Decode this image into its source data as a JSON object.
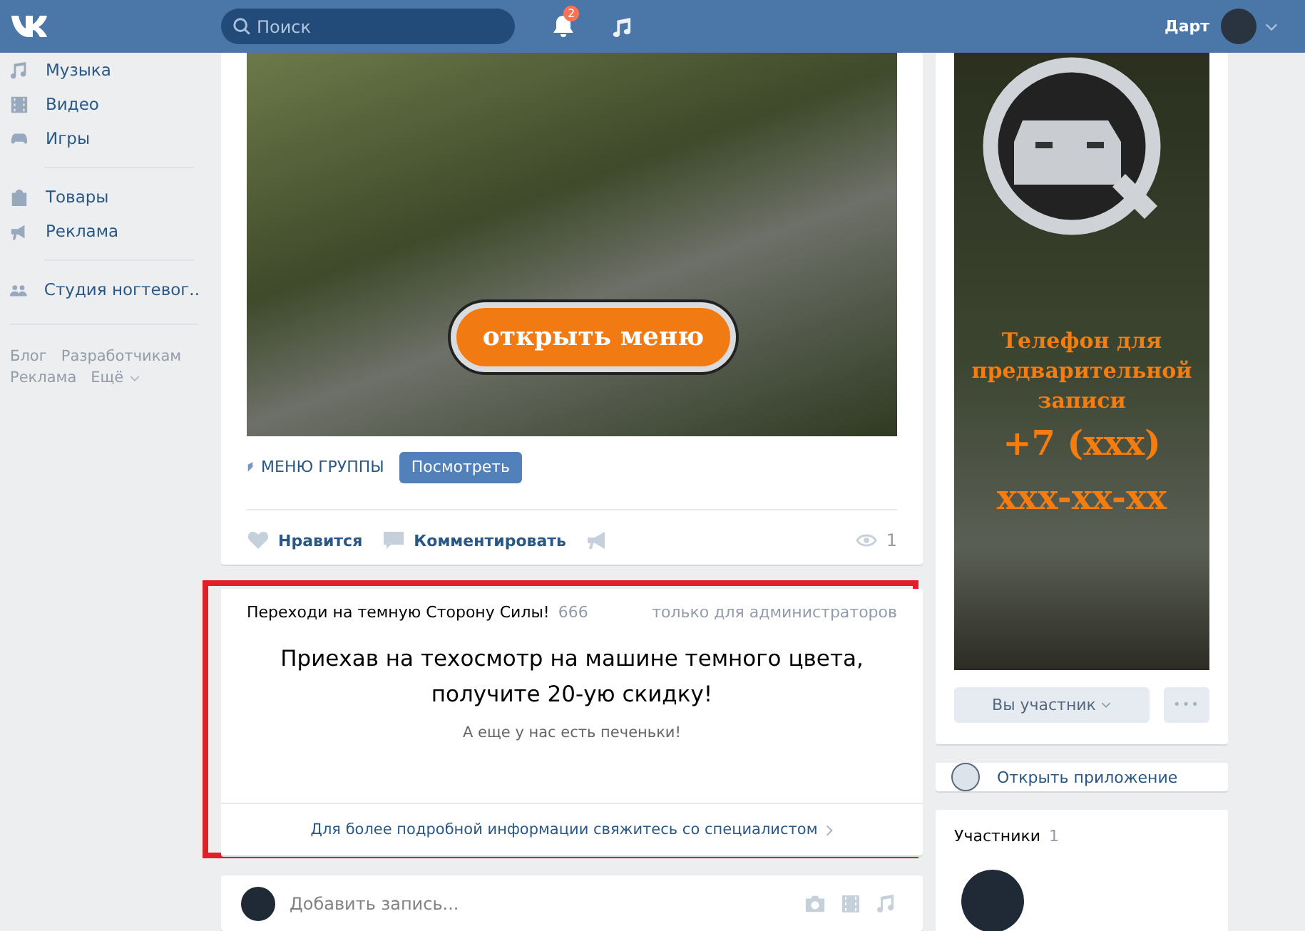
{
  "header": {
    "search": {
      "placeholder": "Поиск"
    },
    "notifications": {
      "count": "2"
    },
    "user": {
      "name": "Дарт"
    }
  },
  "sidebar": {
    "items": [
      {
        "label": "Музыка"
      },
      {
        "label": "Видео"
      },
      {
        "label": "Игры"
      },
      {
        "label": "Товары"
      },
      {
        "label": "Реклама"
      },
      {
        "label": "Студия ногтевог.."
      }
    ],
    "footer_links": [
      "Блог",
      "Разработчикам",
      "Реклама",
      "Ещё"
    ]
  },
  "post": {
    "image_button": "открыть меню",
    "menu_label": "МЕНЮ ГРУППЫ",
    "view_button": "Посмотреть",
    "like": "Нравится",
    "comment": "Комментировать",
    "views": "1"
  },
  "widget": {
    "title": "Переходи на темную Сторону Силы!",
    "count": "666",
    "visibility": "только для администраторов",
    "headline": "Приехав на техосмотр на машине темного цвета, получите 20-ую скидку!",
    "subtitle": "А еще у нас есть печеньки!",
    "footer_link": "Для более подробной информации свяжитесь со специалистом"
  },
  "composer": {
    "placeholder": "Добавить запись..."
  },
  "right": {
    "banner_lines": [
      "Телефон для",
      "предварительной",
      "записи",
      "+7 (xxx)",
      "xxx-xx-xx"
    ],
    "member_button": "Вы участник",
    "more_button": "•••",
    "app_link": "Открыть приложение",
    "members": {
      "title": "Участники",
      "count": "1"
    }
  }
}
